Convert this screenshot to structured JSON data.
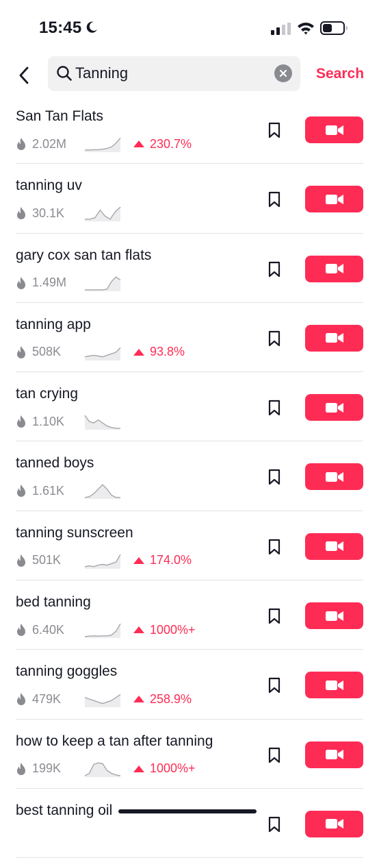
{
  "status": {
    "time": "15:45"
  },
  "search": {
    "query": "Tanning",
    "button_label": "Search"
  },
  "colors": {
    "accent": "#fe2c55",
    "muted": "#8a8b91"
  },
  "results": [
    {
      "title": "San Tan Flats",
      "views": "2.02M",
      "growth": "230.7%",
      "trend": [
        0.1,
        0.1,
        0.12,
        0.12,
        0.15,
        0.2,
        0.3,
        0.55,
        0.9
      ]
    },
    {
      "title": "tanning uv",
      "views": "30.1K",
      "growth": null,
      "trend": [
        0.1,
        0.1,
        0.2,
        0.7,
        0.3,
        0.1,
        0.6,
        0.9
      ]
    },
    {
      "title": "gary cox san tan flats",
      "views": "1.49M",
      "growth": null,
      "trend": [
        0.05,
        0.05,
        0.05,
        0.05,
        0.05,
        0.1,
        0.6,
        0.9,
        0.7
      ]
    },
    {
      "title": "tanning app",
      "views": "508K",
      "growth": "93.8%",
      "trend": [
        0.2,
        0.25,
        0.3,
        0.25,
        0.2,
        0.3,
        0.4,
        0.5,
        0.8
      ]
    },
    {
      "title": "tan crying",
      "views": "1.10K",
      "growth": null,
      "trend": [
        0.9,
        0.5,
        0.4,
        0.6,
        0.4,
        0.2,
        0.1,
        0.05,
        0.05
      ]
    },
    {
      "title": "tanned boys",
      "views": "1.61K",
      "growth": null,
      "trend": [
        0.05,
        0.1,
        0.3,
        0.6,
        0.9,
        0.6,
        0.2,
        0.05,
        0.05
      ]
    },
    {
      "title": "tanning sunscreen",
      "views": "501K",
      "growth": "174.0%",
      "trend": [
        0.1,
        0.15,
        0.1,
        0.2,
        0.25,
        0.2,
        0.3,
        0.4,
        0.9
      ]
    },
    {
      "title": "bed tanning",
      "views": "6.40K",
      "growth": "1000%+",
      "trend": [
        0.05,
        0.08,
        0.1,
        0.08,
        0.1,
        0.1,
        0.15,
        0.4,
        0.9
      ]
    },
    {
      "title": "tanning goggles",
      "views": "479K",
      "growth": "258.9%",
      "trend": [
        0.6,
        0.5,
        0.4,
        0.3,
        0.2,
        0.3,
        0.4,
        0.6,
        0.8
      ]
    },
    {
      "title": "how to keep a tan after tanning",
      "views": "199K",
      "growth": "1000%+",
      "trend": [
        0.05,
        0.2,
        0.8,
        0.9,
        0.85,
        0.4,
        0.2,
        0.1,
        0.05
      ]
    },
    {
      "title": "best tanning oil",
      "views": "",
      "growth": null,
      "trend": []
    }
  ]
}
